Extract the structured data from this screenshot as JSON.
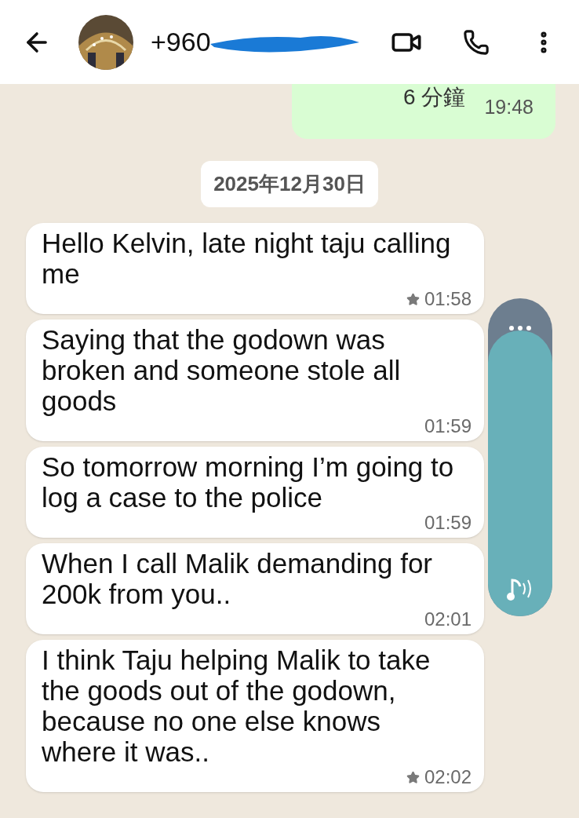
{
  "header": {
    "contact": "+960"
  },
  "previous_message": {
    "text": "6 分鐘",
    "time": "19:48"
  },
  "date_chip": "2025年12月30日",
  "messages": [
    {
      "text": "Hello Kelvin, late night taju calling me",
      "time": "01:58",
      "starred": true
    },
    {
      "text": "Saying that the godown was broken and someone stole all goods",
      "time": "01:59",
      "starred": false
    },
    {
      "text": "So tomorrow morning I’m going to log a case to the police",
      "time": "01:59",
      "starred": false
    },
    {
      "text": "When I call Malik demanding for 200k from you..",
      "time": "02:01",
      "starred": false
    },
    {
      "text": "I think Taju helping Malik to take the goods out of the godown, because no one else knows where it was..",
      "time": "02:02",
      "starred": true
    }
  ],
  "volume_slider": {
    "level": 0.9
  }
}
